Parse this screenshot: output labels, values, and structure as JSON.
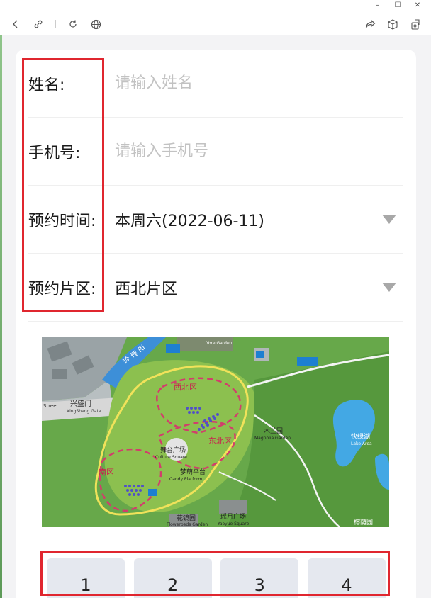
{
  "window": {
    "controls": [
      "–",
      "☐",
      "✕"
    ]
  },
  "toolbar": {
    "icons_left": [
      "back-icon",
      "link-icon",
      "refresh-icon",
      "globe-icon"
    ],
    "icons_right": [
      "share-icon",
      "cube-icon",
      "export-icon"
    ]
  },
  "form": {
    "name": {
      "label": "姓名:",
      "placeholder": "请输入姓名"
    },
    "phone": {
      "label": "手机号:",
      "placeholder": "请输入手机号"
    },
    "time": {
      "label": "预约时间:",
      "value": "本周六(2022-06-11)"
    },
    "zone": {
      "label": "预约片区:",
      "value": "西北片区"
    }
  },
  "map": {
    "labels": {
      "gate": "兴盛门",
      "gate_en": "XingSheng Gate",
      "street": "Street",
      "northwest": "西北区",
      "northeast": "东北区",
      "south": "南区",
      "stage": "舞台广场",
      "stage_en": "Culture Square",
      "platform": "梦萌平台",
      "platform_en": "Candy Platform",
      "magnolia": "木兰园",
      "magnolia_en": "Magnolia Garden",
      "lake": "快绿湖",
      "lake_en": "Lake Area",
      "garden": "Yore Garden",
      "river": "玲 瑰 Ri",
      "bottom1": "花镜园",
      "bottom1_en": "Flowerbeds Garden",
      "bottom2": "瑶月广场",
      "bottom2_en": "Yaoyue Square",
      "bottom3": "榕荫园"
    }
  },
  "numbers": [
    "1",
    "2",
    "3",
    "4"
  ]
}
